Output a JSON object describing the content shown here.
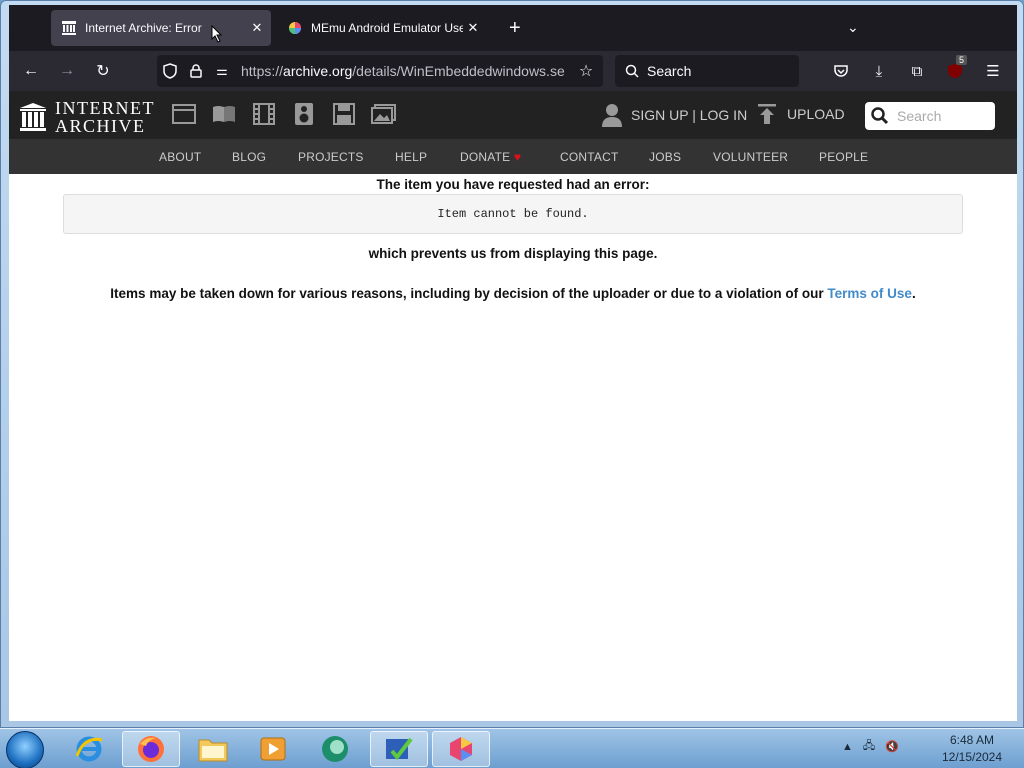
{
  "browser": {
    "tabs": [
      {
        "title": "Internet Archive: Error",
        "active": true
      },
      {
        "title": "MEmu Android Emulator User G",
        "active": false
      }
    ],
    "url": {
      "prefix": "https://",
      "host": "archive.org",
      "path": "/details/WinEmbeddedwindows.se"
    },
    "search_placeholder": "Search",
    "extension_badge": "5"
  },
  "ia": {
    "logo_line1": "INTERNET",
    "logo_line2": "ARCHIVE",
    "signup": "SIGN UP | LOG IN",
    "upload": "UPLOAD",
    "search_placeholder": "Search",
    "nav": [
      {
        "label": "ABOUT"
      },
      {
        "label": "BLOG"
      },
      {
        "label": "PROJECTS"
      },
      {
        "label": "HELP"
      },
      {
        "label": "DONATE"
      },
      {
        "label": "CONTACT"
      },
      {
        "label": "JOBS"
      },
      {
        "label": "VOLUNTEER"
      },
      {
        "label": "PEOPLE"
      }
    ]
  },
  "error": {
    "heading": "The item you have requested had an error:",
    "message": "Item cannot be found.",
    "prevents": "which prevents us from displaying this page.",
    "reason": "Items may be taken down for various reasons, including by decision of the uploader or due to a violation of our ",
    "terms_link": "Terms of Use",
    "period": "."
  },
  "taskbar": {
    "time": "6:48 AM",
    "date": "12/15/2024"
  },
  "colors": {
    "accent_link": "#428bca",
    "donate_heart": "#e0101a",
    "browser_chrome": "#2b2a33"
  }
}
